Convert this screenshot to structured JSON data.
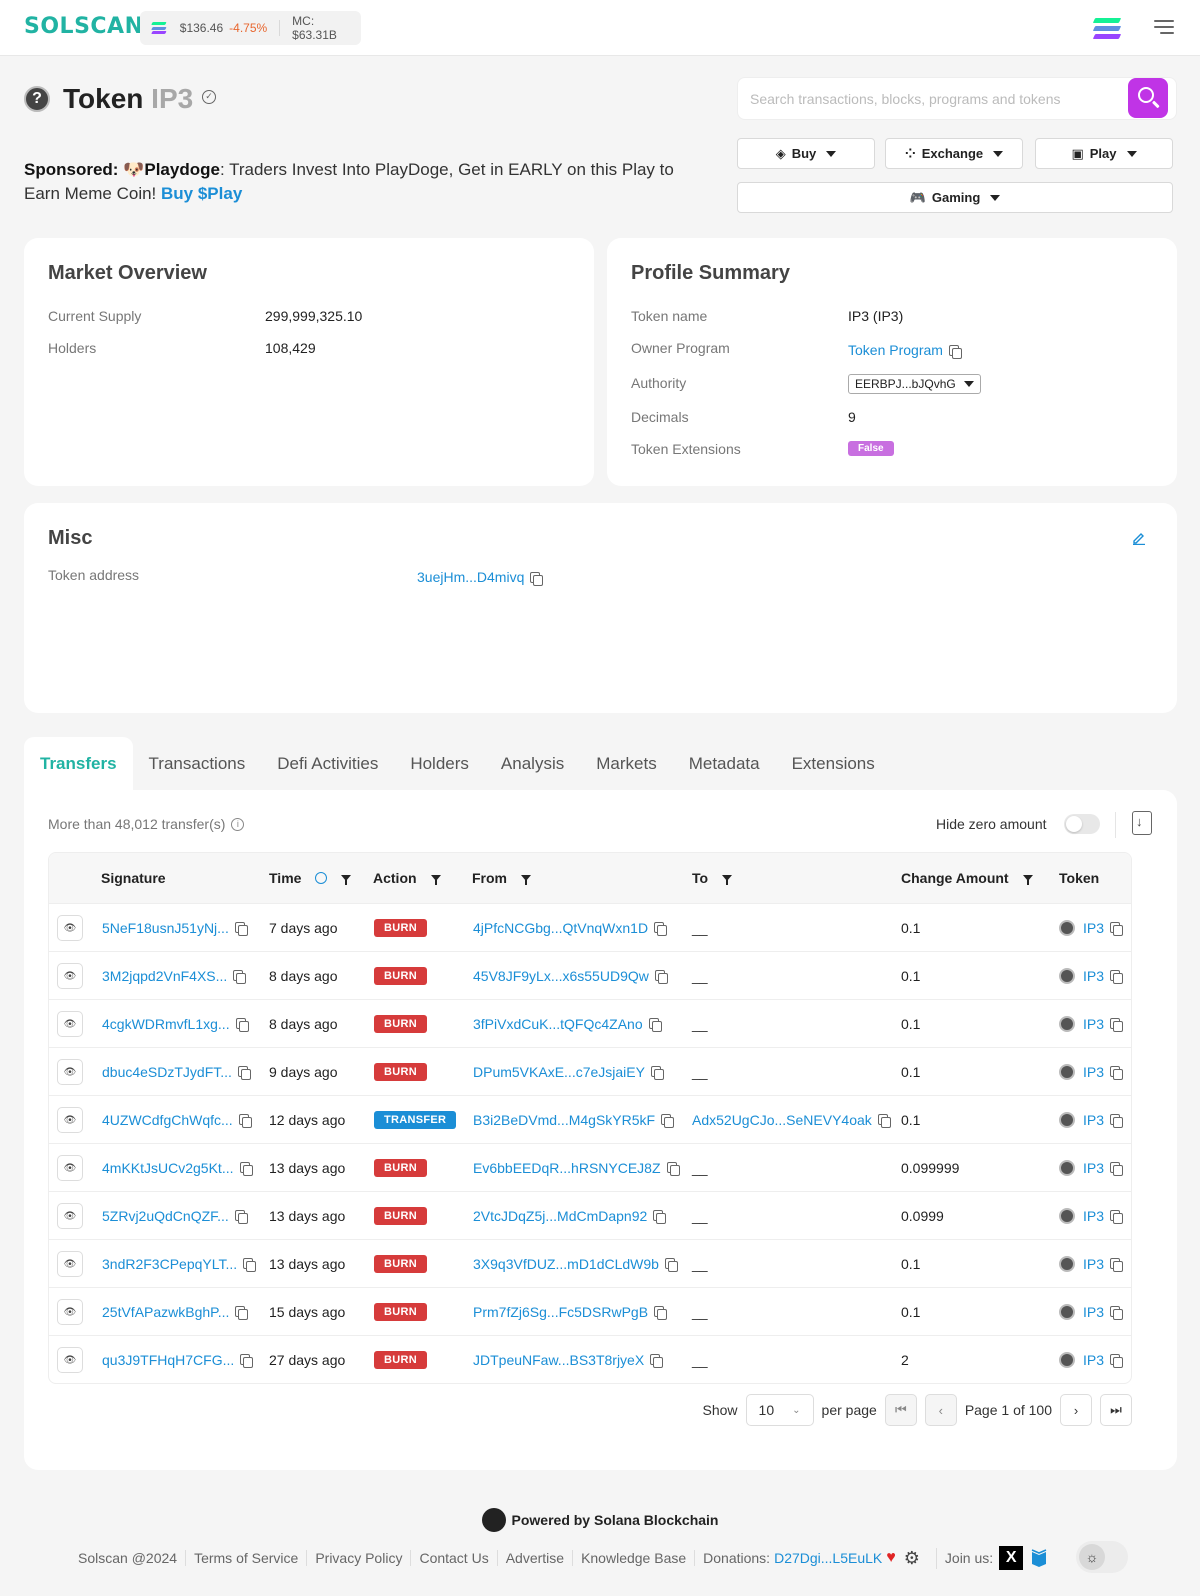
{
  "header": {
    "logo": "SOLSCAN",
    "sol_price": "$136.46",
    "sol_change": "-4.75%",
    "market_cap": "MC: $63.31B",
    "brand_color": "#21b3a3",
    "negative_color": "#e8662e"
  },
  "title": {
    "label": "Token",
    "symbol": "IP3"
  },
  "search": {
    "placeholder": "Search transactions, blocks, programs and tokens",
    "button_color": "#c034e6"
  },
  "actions": {
    "buy": "Buy",
    "exchange": "Exchange",
    "play": "Play",
    "gaming": "Gaming"
  },
  "sponsored": {
    "prefix": "Sponsored:",
    "name": "Playdoge",
    "text": ": Traders Invest Into PlayDoge, Get in EARLY on this Play to Earn Meme Coin!",
    "cta": "Buy $Play"
  },
  "market_overview": {
    "title": "Market Overview",
    "rows": [
      {
        "label": "Current Supply",
        "value": "299,999,325.10"
      },
      {
        "label": "Holders",
        "value": "108,429"
      }
    ]
  },
  "profile_summary": {
    "title": "Profile Summary",
    "token_name_label": "Token name",
    "token_name": "IP3 (IP3)",
    "owner_label": "Owner Program",
    "owner": "Token Program",
    "authority_label": "Authority",
    "authority": "EERBPJ...bJQvhG",
    "decimals_label": "Decimals",
    "decimals": "9",
    "extensions_label": "Token Extensions",
    "extensions": "False"
  },
  "misc": {
    "title": "Misc",
    "address_label": "Token address",
    "address": "3uejHm...D4mivq"
  },
  "tabs": [
    "Transfers",
    "Transactions",
    "Defi Activities",
    "Holders",
    "Analysis",
    "Markets",
    "Metadata",
    "Extensions"
  ],
  "transfers": {
    "count_text": "More than 48,012 transfer(s)",
    "hide_zero_label": "Hide zero amount",
    "columns": [
      "Signature",
      "Time",
      "Action",
      "From",
      "To",
      "Change Amount",
      "Token"
    ],
    "rows": [
      {
        "sig": "5NeF18usnJ51yNj...",
        "time": "7 days ago",
        "action": "BURN",
        "from": "4jPfcNCGbg...QtVnqWxn1D",
        "to": "__",
        "amount": "0.1",
        "token": "IP3"
      },
      {
        "sig": "3M2jqpd2VnF4XS...",
        "time": "8 days ago",
        "action": "BURN",
        "from": "45V8JF9yLx...x6s55UD9Qw",
        "to": "__",
        "amount": "0.1",
        "token": "IP3"
      },
      {
        "sig": "4cgkWDRmvfL1xg...",
        "time": "8 days ago",
        "action": "BURN",
        "from": "3fPiVxdCuK...tQFQc4ZAno",
        "to": "__",
        "amount": "0.1",
        "token": "IP3"
      },
      {
        "sig": "dbuc4eSDzTJydFT...",
        "time": "9 days ago",
        "action": "BURN",
        "from": "DPum5VKAxE...c7eJsjaiEY",
        "to": "__",
        "amount": "0.1",
        "token": "IP3"
      },
      {
        "sig": "4UZWCdfgChWqfc...",
        "time": "12 days ago",
        "action": "TRANSFER",
        "from": "B3i2BeDVmd...M4gSkYR5kF",
        "to": "Adx52UgCJo...SeNEVY4oak",
        "amount": "0.1",
        "token": "IP3"
      },
      {
        "sig": "4mKKtJsUCv2g5Kt...",
        "time": "13 days ago",
        "action": "BURN",
        "from": "Ev6bbEEDqR...hRSNYCEJ8Z",
        "to": "__",
        "amount": "0.099999",
        "token": "IP3"
      },
      {
        "sig": "5ZRvj2uQdCnQZF...",
        "time": "13 days ago",
        "action": "BURN",
        "from": "2VtcJDqZ5j...MdCmDapn92",
        "to": "__",
        "amount": "0.0999",
        "token": "IP3"
      },
      {
        "sig": "3ndR2F3CPepqYLT...",
        "time": "13 days ago",
        "action": "BURN",
        "from": "3X9q3VfDUZ...mD1dCLdW9b",
        "to": "__",
        "amount": "0.1",
        "token": "IP3"
      },
      {
        "sig": "25tVfAPazwkBghP...",
        "time": "15 days ago",
        "action": "BURN",
        "from": "Prm7fZj6Sg...Fc5DSRwPgB",
        "to": "__",
        "amount": "0.1",
        "token": "IP3"
      },
      {
        "sig": "qu3J9TFHqH7CFG...",
        "time": "27 days ago",
        "action": "BURN",
        "from": "JDTpeuNFaw...BS3T8rjyeX",
        "to": "__",
        "amount": "2",
        "token": "IP3"
      }
    ],
    "pager": {
      "show": "Show",
      "per_page_value": "10",
      "per_page": "per page",
      "page_text": "Page 1 of 100"
    }
  },
  "footer": {
    "powered": "Powered by Solana Blockchain",
    "links": [
      "Solscan @2024",
      "Terms of Service",
      "Privacy Policy",
      "Contact Us",
      "Advertise",
      "Knowledge Base"
    ],
    "donations_label": "Donations:",
    "donations_address": "D27Dgi...L5EuLK",
    "join_us": "Join us:"
  }
}
